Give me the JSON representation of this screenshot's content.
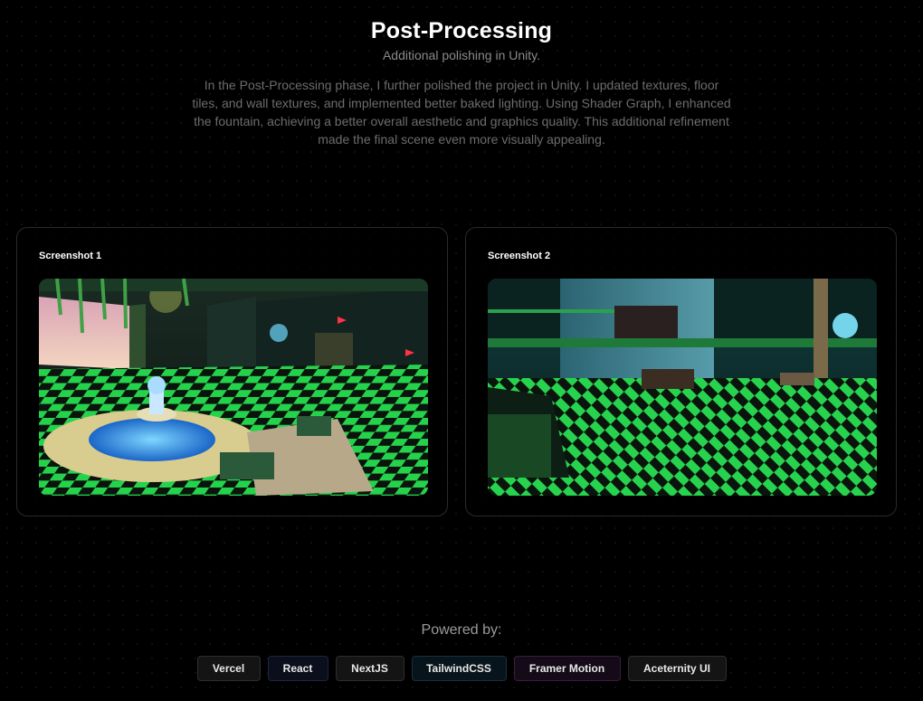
{
  "header": {
    "title": "Post-Processing",
    "subtitle": "Additional polishing in Unity.",
    "description": "In the Post-Processing phase, I further polished the project in Unity. I updated textures, floor tiles, and wall textures, and implemented better baked lighting. Using Shader Graph, I enhanced the fountain, achieving a better overall aesthetic and graphics quality. This additional refinement made the final scene even more visually appealing."
  },
  "screenshots": [
    {
      "title": "Screenshot 1"
    },
    {
      "title": "Screenshot 2"
    }
  ],
  "footer": {
    "powered_label": "Powered by:",
    "badges": [
      "Vercel",
      "React",
      "NextJS",
      "TailwindCSS",
      "Framer Motion",
      "Aceternity UI"
    ]
  },
  "colors": {
    "background": "#000000",
    "floor_green": "#1fd14a",
    "floor_dark": "#0b140c"
  }
}
